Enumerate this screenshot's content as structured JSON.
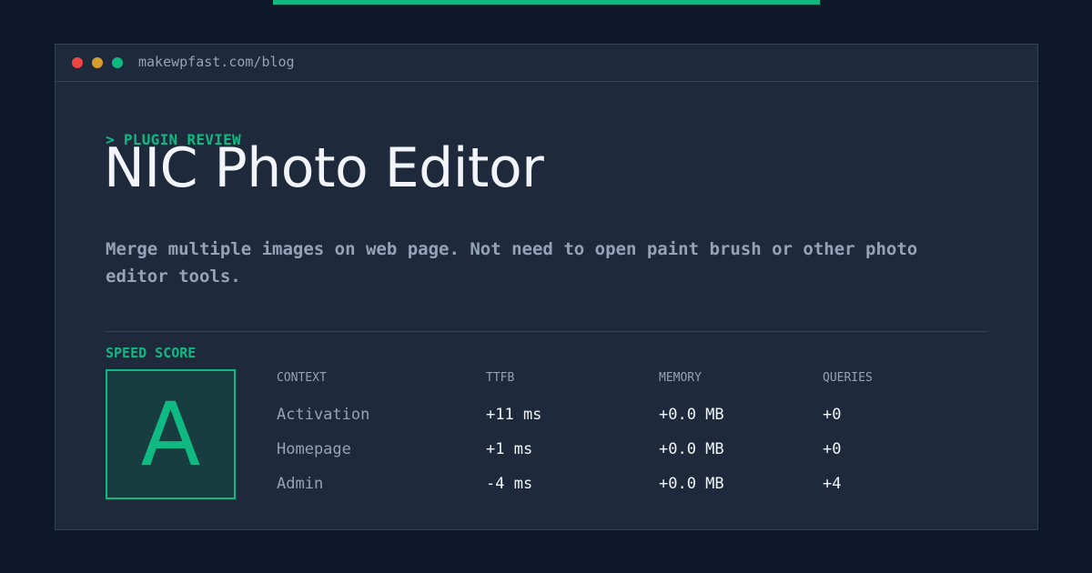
{
  "accent_color": "#10b981",
  "window": {
    "url": "makewpfast.com/blog"
  },
  "article": {
    "kicker": "> PLUGIN REVIEW",
    "title": "NIC Photo Editor",
    "description": "Merge multiple images on web page. Not need to open paint brush or other photo editor tools."
  },
  "speed": {
    "label": "SPEED SCORE",
    "grade": "A"
  },
  "table": {
    "headers": [
      "CONTEXT",
      "TTFB",
      "MEMORY",
      "QUERIES"
    ],
    "rows": [
      [
        "Activation",
        "+11 ms",
        "+0.0 MB",
        "+0"
      ],
      [
        "Homepage",
        "+1 ms",
        "+0.0 MB",
        "+0"
      ],
      [
        "Admin",
        "-4 ms",
        "+0.0 MB",
        "+4"
      ]
    ]
  }
}
